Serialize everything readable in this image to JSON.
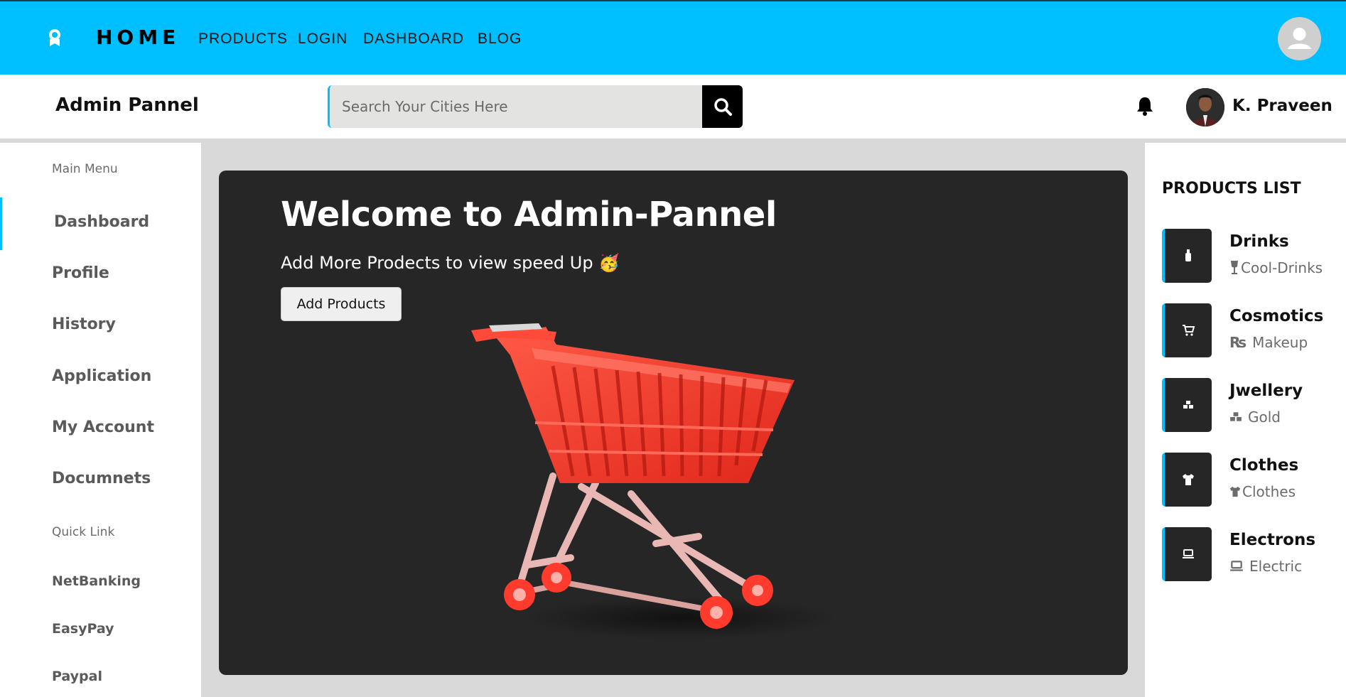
{
  "nav": {
    "brand": "HOME",
    "links": [
      "PRODUCTS",
      "LOGIN",
      "DASHBOARD",
      "BLOG"
    ]
  },
  "header": {
    "title": "Admin Pannel",
    "search_placeholder": "Search Your Cities Here",
    "user_name": "K. Praveen"
  },
  "sidebar": {
    "main_heading": "Main Menu",
    "main_items": [
      "Dashboard",
      "Profile",
      "History",
      "Application",
      "My Account",
      "Documnets"
    ],
    "quick_heading": "Quick Link",
    "quick_items": [
      "NetBanking",
      "EasyPay",
      "Paypal"
    ],
    "active_item": "Dashboard"
  },
  "banner": {
    "title": "Welcome to Admin-Pannel",
    "subtitle": "Add More Prodects to view speed Up 🥳",
    "button_label": "Add Products"
  },
  "products": {
    "title": "PRODUCTS LIST",
    "items": [
      {
        "name": "Drinks",
        "sub": "Cool-Drinks",
        "icon": "bottle-icon",
        "sub_icon": "wine-glass-icon"
      },
      {
        "name": "Cosmotics",
        "sub": "Makeup",
        "icon": "cart-icon",
        "sub_icon": "rupee-icon"
      },
      {
        "name": "Jwellery",
        "sub": "Gold",
        "icon": "gold-bars-icon",
        "sub_icon": "gold-bars-icon"
      },
      {
        "name": "Clothes",
        "sub": "Clothes",
        "icon": "shirt-icon",
        "sub_icon": "shirt-icon"
      },
      {
        "name": "Electrons",
        "sub": "Electric",
        "icon": "laptop-icon",
        "sub_icon": "laptop-icon"
      }
    ]
  },
  "colors": {
    "accent": "#00bfff",
    "dark_panel": "#262626",
    "cart_red": "#ff3b2e"
  }
}
